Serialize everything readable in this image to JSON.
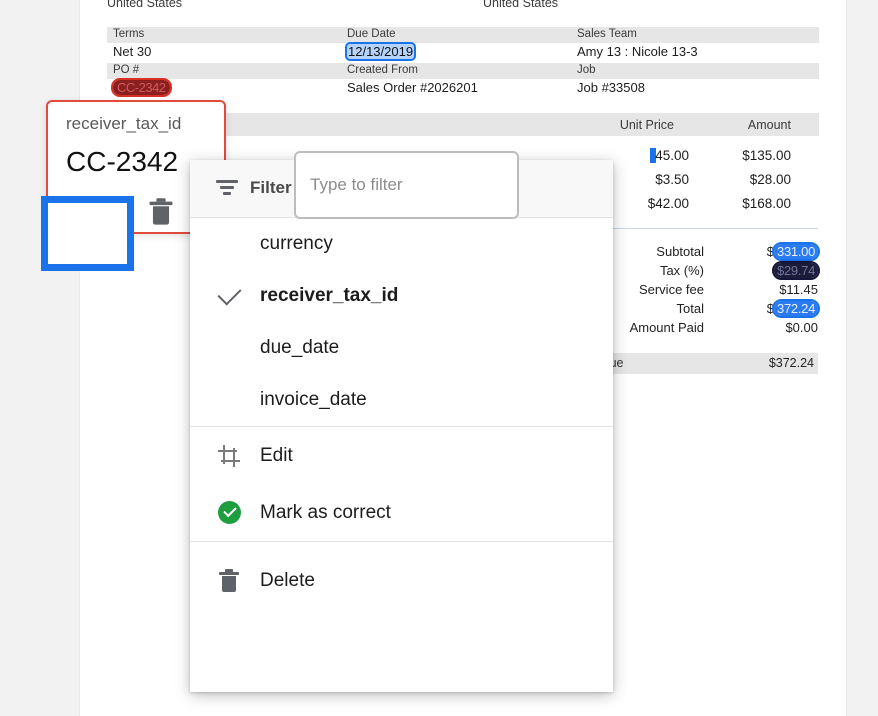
{
  "document": {
    "address_left": "United States",
    "address_right": "United States",
    "meta": [
      {
        "headers": [
          "Terms",
          "Due Date",
          "Sales Team"
        ],
        "values": [
          "Net 30",
          "12/13/2019",
          "Amy 13 : Nicole 13-3"
        ],
        "highlight": [
          null,
          "blue",
          null
        ]
      },
      {
        "headers": [
          "PO #",
          "Created From",
          "Job"
        ],
        "values": [
          "CC-2342",
          "Sales Order #2026201",
          "Job #33508"
        ],
        "highlight": [
          "red",
          null,
          null
        ]
      }
    ],
    "items_header": {
      "unit_price": "Unit Price",
      "amount": "Amount"
    },
    "items": [
      {
        "unit_price": "45.00",
        "amount": "$135.00",
        "caret": true
      },
      {
        "unit_price": "$3.50",
        "amount": "$28.00",
        "caret": false
      },
      {
        "unit_price": "$42.00",
        "amount": "$168.00",
        "caret": false
      }
    ],
    "totals": [
      {
        "label": "Subtotal",
        "value": "331.00",
        "prefix": "$",
        "highlight": "blue"
      },
      {
        "label": "Tax (%)",
        "value": "$29.74",
        "prefix": "",
        "highlight": "dark"
      },
      {
        "label": "Service fee",
        "value": "$11.45",
        "prefix": "",
        "highlight": null
      },
      {
        "label": "Total",
        "value": "372.24",
        "prefix": "$",
        "highlight": "blue"
      },
      {
        "label": "Amount Paid",
        "value": "$0.00",
        "prefix": "",
        "highlight": null
      }
    ],
    "amount_due": {
      "label": "Amount Due",
      "value": "$372.24"
    }
  },
  "field_card": {
    "key": "receiver_tax_id",
    "value": "CC-2342",
    "accept_icon": "check-circle-outline-icon",
    "delete_icon": "trash-icon"
  },
  "context_menu": {
    "filter_label": "Filter",
    "filter_placeholder": "Type to filter",
    "filter_value": "",
    "filter_icon": "filter-icon",
    "fields": [
      {
        "label": "currency",
        "checked": false
      },
      {
        "label": "receiver_tax_id",
        "checked": true
      },
      {
        "label": "due_date",
        "checked": false
      },
      {
        "label": "invoice_date",
        "checked": false
      }
    ],
    "actions": [
      {
        "label": "Edit",
        "icon": "crop-icon"
      },
      {
        "label": "Mark as correct",
        "icon": "check-circle-filled-icon"
      }
    ],
    "destructive": [
      {
        "label": "Delete",
        "icon": "trash-icon"
      }
    ]
  },
  "colors": {
    "accent_blue": "#1a73e8",
    "callout_red": "#e24b3c",
    "success_green": "#1e9e3e",
    "icon_gray": "#5f6368",
    "page_bg": "#f2f2f2"
  }
}
